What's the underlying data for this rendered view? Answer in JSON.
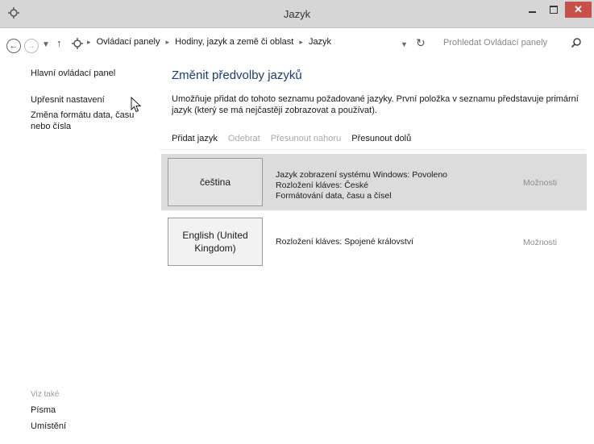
{
  "window": {
    "title": "Jazyk",
    "close_glyph": "✕"
  },
  "address": {
    "back_icon": "back-arrow-icon",
    "forward_icon": "forward-arrow-icon",
    "up_icon": "up-arrow-icon",
    "breadcrumb": [
      "Ovládací panely",
      "Hodiny, jazyk a země či oblast",
      "Jazyk"
    ],
    "search_placeholder": "Prohledat Ovládací panely"
  },
  "sidebar": {
    "home": "Hlavní ovládací panel",
    "advanced": "Upřesnit nastavení",
    "date_format": "Změna formátu data, času nebo čísla",
    "see_also": "Viz také",
    "fonts": "Písma",
    "location": "Umístění"
  },
  "main": {
    "heading": "Změnit předvolby jazyků",
    "description": "Umožňuje přidat do tohoto seznamu požadované jazyky. První položka v seznamu představuje primární jazyk (který se má nejčastěji zobrazovat a používat).",
    "toolbar": {
      "add": "Přidat jazyk",
      "remove": "Odebrat",
      "move_up": "Přesunout nahoru",
      "move_down": "Přesunout dolů"
    },
    "languages": [
      {
        "name": "čeština",
        "details": [
          "Jazyk zobrazení systému Windows: Povoleno",
          "Rozložení kláves: České",
          "Formátování data, času a čísel"
        ],
        "options": "Možnosti"
      },
      {
        "name": "English (United Kingdom)",
        "details": [
          "Rozložení kláves: Spojené království"
        ],
        "options": "Možnosti"
      }
    ]
  },
  "colors": {
    "titlebar": "#d6d6d6",
    "close_button": "#c7504b",
    "heading": "#1e3d6e",
    "selected_row": "#dcdcdc"
  }
}
